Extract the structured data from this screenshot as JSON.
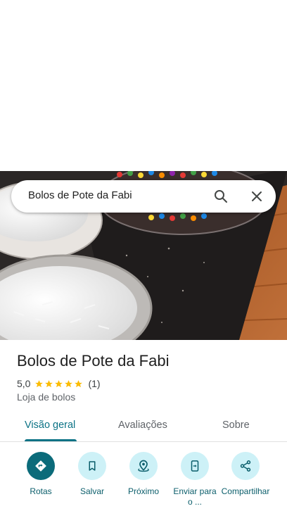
{
  "search": {
    "query": "Bolos de Pote da Fabi"
  },
  "place": {
    "name": "Bolos de Pote da Fabi",
    "rating": "5,0",
    "stars": 5,
    "review_count": "(1)",
    "category": "Loja de bolos"
  },
  "tabs": [
    {
      "label": "Visão geral",
      "active": true
    },
    {
      "label": "Avaliações",
      "active": false
    },
    {
      "label": "Sobre",
      "active": false
    }
  ],
  "actions": [
    {
      "label": "Rotas",
      "icon": "directions-icon"
    },
    {
      "label": "Salvar",
      "icon": "bookmark-icon"
    },
    {
      "label": "Próximo",
      "icon": "nearby-icon"
    },
    {
      "label": "Enviar para o ...",
      "icon": "send-to-phone-icon"
    },
    {
      "label": "Compartilhar",
      "icon": "share-icon"
    }
  ],
  "colors": {
    "accent": "#0b7285",
    "primary_action": "#0b6b7a",
    "action_bg": "#cdf1f7",
    "star": "#fbbc04"
  }
}
